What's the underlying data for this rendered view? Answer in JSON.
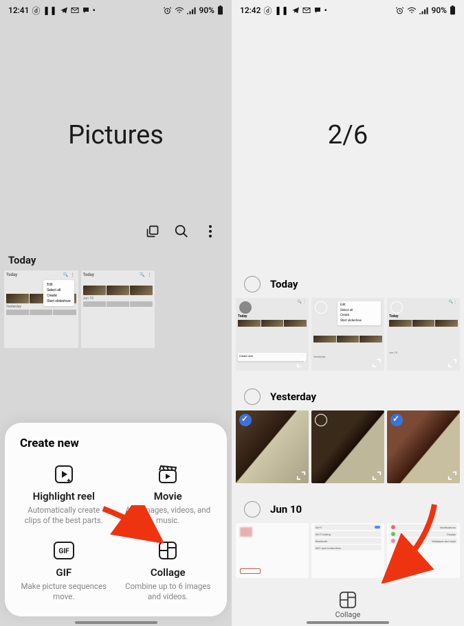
{
  "left": {
    "status": {
      "time": "12:41",
      "battery": "90%"
    },
    "title": "Pictures",
    "sections": {
      "today": "Today",
      "yesterday": "Yesterday"
    },
    "thumb_menu": {
      "edit": "Edit",
      "select_all": "Select all",
      "create": "Create",
      "slideshow": "Start slideshow"
    },
    "mini_date": "Jun 10",
    "sheet": {
      "title": "Create new",
      "highlight": {
        "title": "Highlight reel",
        "sub": "Automatically create clips of the best parts."
      },
      "movie": {
        "title": "Movie",
        "sub": "Add images, videos, and music."
      },
      "gif": {
        "title": "GIF",
        "sub": "Make picture sequences move."
      },
      "collage": {
        "title": "Collage",
        "sub": "Combine up to 6 images and videos."
      },
      "gif_label": "GIF"
    }
  },
  "right": {
    "status": {
      "time": "12:42",
      "battery": "90%"
    },
    "title": "2/6",
    "sections": {
      "today": "Today",
      "yesterday": "Yesterday",
      "jun10": "Jun 10"
    },
    "thumb_menu": {
      "edit": "Edit",
      "select_all": "Select all",
      "create": "Create",
      "slideshow": "Start slideshow"
    },
    "create_new_label": "Create new",
    "settings_rows": {
      "wifi": "Wi-Fi",
      "wifi_calling": "Wi-Fi Calling",
      "bluetooth": "Bluetooth",
      "nfc": "NFC and contactless"
    },
    "settings2": {
      "notifications": "Notifications",
      "display": "Display",
      "wallpaper": "Wallpaper and style"
    },
    "bottom": {
      "collage": "Collage"
    }
  }
}
